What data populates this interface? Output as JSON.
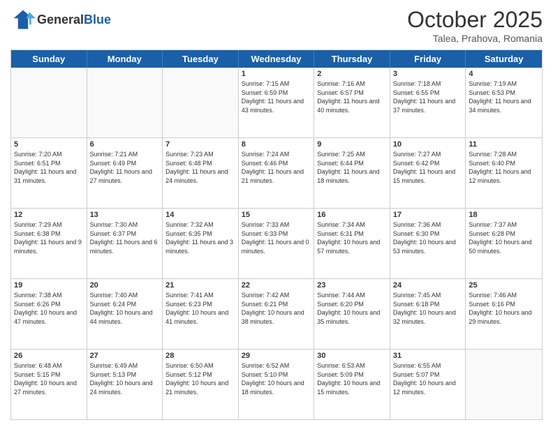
{
  "logo": {
    "text_general": "General",
    "text_blue": "Blue"
  },
  "title": "October 2025",
  "subtitle": "Talea, Prahova, Romania",
  "days_of_week": [
    "Sunday",
    "Monday",
    "Tuesday",
    "Wednesday",
    "Thursday",
    "Friday",
    "Saturday"
  ],
  "weeks": [
    [
      {
        "day": "",
        "info": ""
      },
      {
        "day": "",
        "info": ""
      },
      {
        "day": "",
        "info": ""
      },
      {
        "day": "1",
        "info": "Sunrise: 7:15 AM\nSunset: 6:59 PM\nDaylight: 11 hours and 43 minutes."
      },
      {
        "day": "2",
        "info": "Sunrise: 7:16 AM\nSunset: 6:57 PM\nDaylight: 11 hours and 40 minutes."
      },
      {
        "day": "3",
        "info": "Sunrise: 7:18 AM\nSunset: 6:55 PM\nDaylight: 11 hours and 37 minutes."
      },
      {
        "day": "4",
        "info": "Sunrise: 7:19 AM\nSunset: 6:53 PM\nDaylight: 11 hours and 34 minutes."
      }
    ],
    [
      {
        "day": "5",
        "info": "Sunrise: 7:20 AM\nSunset: 6:51 PM\nDaylight: 11 hours and 31 minutes."
      },
      {
        "day": "6",
        "info": "Sunrise: 7:21 AM\nSunset: 6:49 PM\nDaylight: 11 hours and 27 minutes."
      },
      {
        "day": "7",
        "info": "Sunrise: 7:23 AM\nSunset: 6:48 PM\nDaylight: 11 hours and 24 minutes."
      },
      {
        "day": "8",
        "info": "Sunrise: 7:24 AM\nSunset: 6:46 PM\nDaylight: 11 hours and 21 minutes."
      },
      {
        "day": "9",
        "info": "Sunrise: 7:25 AM\nSunset: 6:44 PM\nDaylight: 11 hours and 18 minutes."
      },
      {
        "day": "10",
        "info": "Sunrise: 7:27 AM\nSunset: 6:42 PM\nDaylight: 11 hours and 15 minutes."
      },
      {
        "day": "11",
        "info": "Sunrise: 7:28 AM\nSunset: 6:40 PM\nDaylight: 11 hours and 12 minutes."
      }
    ],
    [
      {
        "day": "12",
        "info": "Sunrise: 7:29 AM\nSunset: 6:38 PM\nDaylight: 11 hours and 9 minutes."
      },
      {
        "day": "13",
        "info": "Sunrise: 7:30 AM\nSunset: 6:37 PM\nDaylight: 11 hours and 6 minutes."
      },
      {
        "day": "14",
        "info": "Sunrise: 7:32 AM\nSunset: 6:35 PM\nDaylight: 11 hours and 3 minutes."
      },
      {
        "day": "15",
        "info": "Sunrise: 7:33 AM\nSunset: 6:33 PM\nDaylight: 11 hours and 0 minutes."
      },
      {
        "day": "16",
        "info": "Sunrise: 7:34 AM\nSunset: 6:31 PM\nDaylight: 10 hours and 57 minutes."
      },
      {
        "day": "17",
        "info": "Sunrise: 7:36 AM\nSunset: 6:30 PM\nDaylight: 10 hours and 53 minutes."
      },
      {
        "day": "18",
        "info": "Sunrise: 7:37 AM\nSunset: 6:28 PM\nDaylight: 10 hours and 50 minutes."
      }
    ],
    [
      {
        "day": "19",
        "info": "Sunrise: 7:38 AM\nSunset: 6:26 PM\nDaylight: 10 hours and 47 minutes."
      },
      {
        "day": "20",
        "info": "Sunrise: 7:40 AM\nSunset: 6:24 PM\nDaylight: 10 hours and 44 minutes."
      },
      {
        "day": "21",
        "info": "Sunrise: 7:41 AM\nSunset: 6:23 PM\nDaylight: 10 hours and 41 minutes."
      },
      {
        "day": "22",
        "info": "Sunrise: 7:42 AM\nSunset: 6:21 PM\nDaylight: 10 hours and 38 minutes."
      },
      {
        "day": "23",
        "info": "Sunrise: 7:44 AM\nSunset: 6:20 PM\nDaylight: 10 hours and 35 minutes."
      },
      {
        "day": "24",
        "info": "Sunrise: 7:45 AM\nSunset: 6:18 PM\nDaylight: 10 hours and 32 minutes."
      },
      {
        "day": "25",
        "info": "Sunrise: 7:46 AM\nSunset: 6:16 PM\nDaylight: 10 hours and 29 minutes."
      }
    ],
    [
      {
        "day": "26",
        "info": "Sunrise: 6:48 AM\nSunset: 5:15 PM\nDaylight: 10 hours and 27 minutes."
      },
      {
        "day": "27",
        "info": "Sunrise: 6:49 AM\nSunset: 5:13 PM\nDaylight: 10 hours and 24 minutes."
      },
      {
        "day": "28",
        "info": "Sunrise: 6:50 AM\nSunset: 5:12 PM\nDaylight: 10 hours and 21 minutes."
      },
      {
        "day": "29",
        "info": "Sunrise: 6:52 AM\nSunset: 5:10 PM\nDaylight: 10 hours and 18 minutes."
      },
      {
        "day": "30",
        "info": "Sunrise: 6:53 AM\nSunset: 5:09 PM\nDaylight: 10 hours and 15 minutes."
      },
      {
        "day": "31",
        "info": "Sunrise: 6:55 AM\nSunset: 5:07 PM\nDaylight: 10 hours and 12 minutes."
      },
      {
        "day": "",
        "info": ""
      }
    ]
  ]
}
